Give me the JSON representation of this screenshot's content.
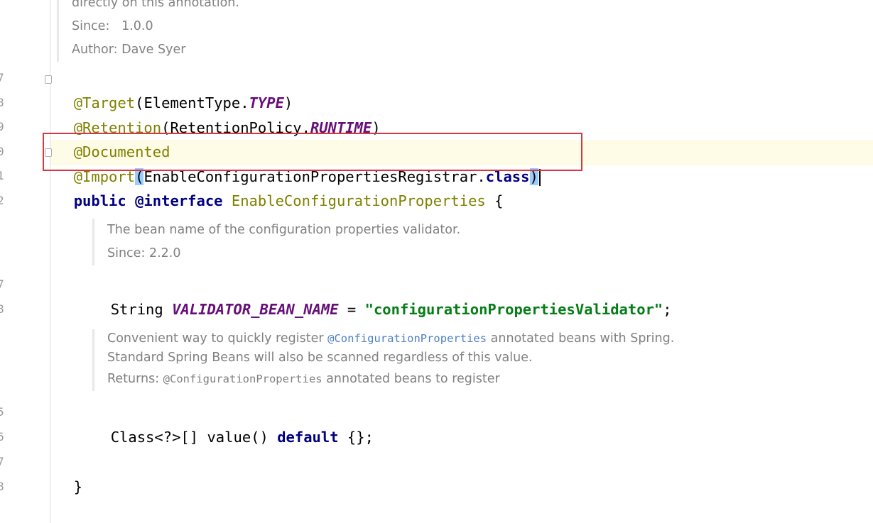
{
  "doc_top": {
    "truncated_line": "directly on this annotation.",
    "since_label": "Since:",
    "since_value": "1.0.0",
    "author_label": "Author:",
    "author_value": "Dave Syer"
  },
  "line_numbers": [
    "7",
    "8",
    "9",
    "0",
    "1",
    "2",
    "7",
    "8",
    "5",
    "6",
    "7",
    "8"
  ],
  "code": {
    "target": {
      "at": "@Target",
      "open": "(",
      "arg": "ElementType.",
      "const": "TYPE",
      "close": ")"
    },
    "retention": {
      "at": "@Retention",
      "open": "(",
      "arg": "RetentionPolicy.",
      "const": "RUNTIME",
      "close": ")"
    },
    "documented": {
      "at": "@Documented"
    },
    "import": {
      "at": "@Import",
      "open": "(",
      "arg": "EnableConfigurationPropertiesRegistrar.",
      "kw": "class",
      "close": ")"
    },
    "declaration": {
      "public": "public",
      "interface": "@interface",
      "name": "EnableConfigurationProperties",
      "brace": " {"
    },
    "field": {
      "type": "String ",
      "name": "VALIDATOR_BEAN_NAME",
      "eq": " = ",
      "value": "\"configurationPropertiesValidator\"",
      "semi": ";"
    },
    "method": {
      "sig": "Class<?>[] value() ",
      "kw": "default",
      "rest": " {};"
    },
    "close_brace": "}"
  },
  "doc_validator": {
    "text": "The bean name of the configuration properties validator.",
    "since_label": "Since:",
    "since_value": "2.2.0"
  },
  "doc_value": {
    "line1_pre": "Convenient way to quickly register ",
    "line1_link": "@ConfigurationProperties",
    "line1_post": " annotated beans with Spring.",
    "line2": "Standard Spring Beans will also be scanned regardless of this value.",
    "returns_label": "Returns:",
    "returns_code": "@ConfigurationProperties",
    "returns_post": " annotated beans to register"
  }
}
